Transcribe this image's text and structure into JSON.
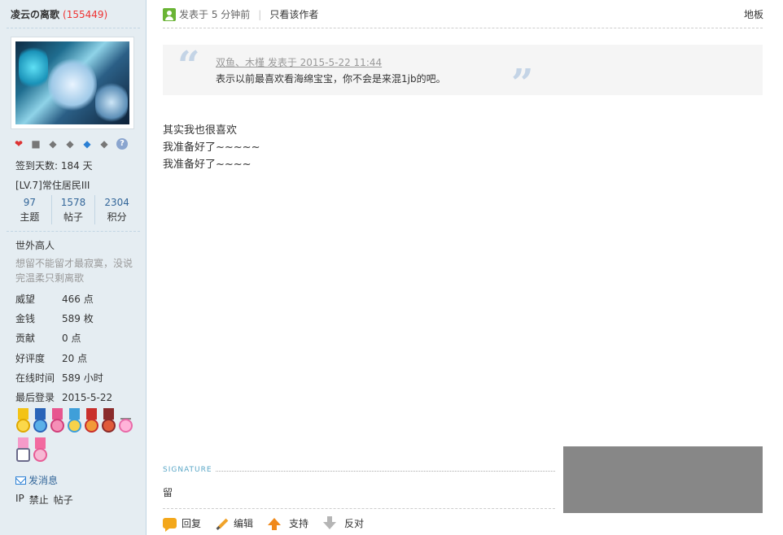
{
  "user": {
    "name": "凌云の离歌",
    "uid": "(155449)",
    "checkin": "签到天数: 184 天",
    "level": "[LV.7]常住居民III",
    "stats": [
      {
        "num": "97",
        "label": "主题"
      },
      {
        "num": "1578",
        "label": "帖子"
      },
      {
        "num": "2304",
        "label": "积分"
      }
    ],
    "title": "世外高人",
    "motto": "想留不能留才最寂寞，没说完温柔只剩离歌",
    "info": [
      {
        "key": "威望",
        "val": "466 点"
      },
      {
        "key": "金钱",
        "val": "589 枚"
      },
      {
        "key": "贡献",
        "val": "0 点"
      },
      {
        "key": "好评度",
        "val": "20 点"
      },
      {
        "key": "在线时间",
        "val": "589 小时"
      },
      {
        "key": "最后登录",
        "val": "2015-5-22"
      }
    ],
    "send_message": "发消息",
    "admin_links": [
      "IP",
      "禁止",
      "帖子"
    ]
  },
  "post": {
    "posted_at": "发表于 5 分钟前",
    "author_only": "只看该作者",
    "floor": "地板",
    "quote_meta": "双鱼、木槿 发表于 2015-5-22 11:44",
    "quote_text": "表示以前最喜欢看海绵宝宝，你不会是来混1jb的吧。",
    "lines": [
      "其实我也很喜欢",
      "我准备好了~~~~~",
      "我准备好了~~~~"
    ],
    "signature_label": "SIGNATURE",
    "signature": "留"
  },
  "actions": {
    "reply": "回复",
    "edit": "编辑",
    "support": "支持",
    "oppose": "反对"
  },
  "colors": {
    "sidebar_bg": "#e5edf2",
    "link_blue": "#336699",
    "uid_red": "#ee3333",
    "quote_bg": "#f5f5f5",
    "gray_box": "#878787"
  }
}
